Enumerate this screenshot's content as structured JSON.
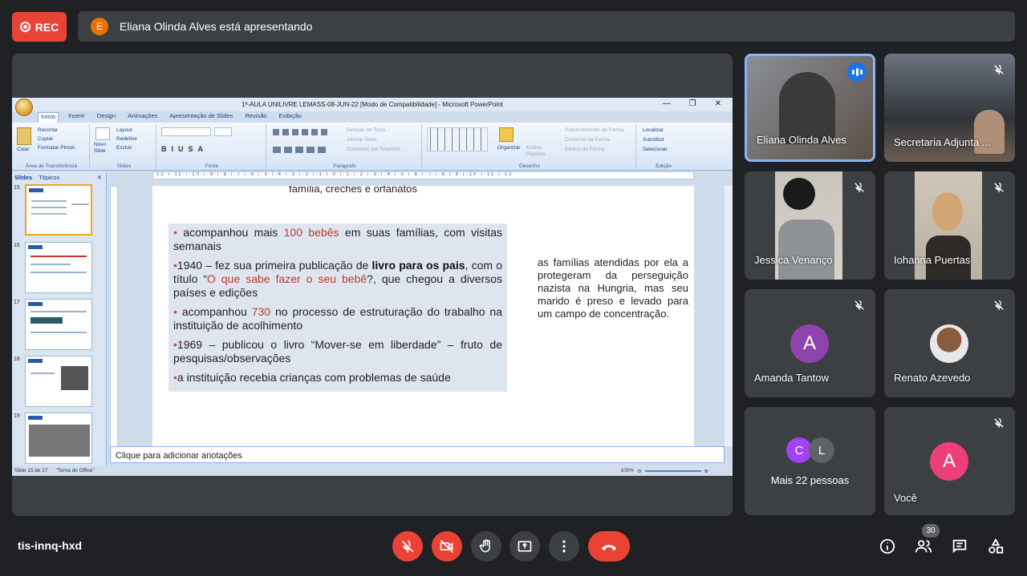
{
  "top_bar": {
    "rec_label": "REC",
    "presenter_initial": "E",
    "presenter_text": "Eliana Olinda Alves está apresentando"
  },
  "ppt": {
    "window_title": "1ª-AULA UNILIVRE LEMASS-08-JUN-22 [Modo de Compatibilidade] - Microsoft PowerPoint",
    "tabs": [
      "Início",
      "Inserir",
      "Design",
      "Animações",
      "Apresentação de Slides",
      "Revisão",
      "Exibição"
    ],
    "ribbon": {
      "clipboard": {
        "paste": "Colar",
        "cut": "Recortar",
        "copy": "Copiar",
        "format_painter": "Formatar Pincel",
        "caption": "Área de Transferência"
      },
      "slides": {
        "new_slide": "Novo Slide",
        "layout": "Layout",
        "reset": "Redefinir",
        "delete": "Excluir",
        "caption": "Slides"
      },
      "font": {
        "caption": "Fonte"
      },
      "paragraph": {
        "text_direction": "Direção do Texto",
        "align_text": "Alinhar Texto",
        "convert_smartart": "Converter em SmartArt",
        "caption": "Parágrafo"
      },
      "drawing": {
        "arrange": "Organizar",
        "quick_styles": "Estilos Rápidos",
        "shape_fill": "Preenchimento da Forma",
        "shape_outline": "Contorno da Forma",
        "shape_effects": "Efeitos de Forma",
        "caption": "Desenho"
      },
      "editing": {
        "find": "Localizar",
        "replace": "Substituir",
        "select": "Selecionar",
        "caption": "Edição"
      }
    },
    "thumb_tabs": [
      "Slides",
      "Tópicos"
    ],
    "thumb_numbers": [
      "15",
      "16",
      "17",
      "18",
      "19"
    ],
    "ruler_text": "·12·ı·11·ı·10·ı·9·ı·8·ı·7·ı·6·ı·5·ı·4·ı·3·ı·2·ı·1·ı·0·ı·1·ı·2·ı·3·ı·4·ı·5·ı·6·ı·7·ı·8·ı·9·ı·10·ı·11·ı·12·",
    "slide": {
      "heading": "família, creches e orfanatos",
      "bullets": [
        {
          "pre": "acompanhou mais ",
          "hl": "100 bebês",
          "post": " em suas famílias, com visitas semanais"
        },
        {
          "year": "1940",
          "pre": " – fez sua primeira publicação de ",
          "bold": "livro para os pais",
          "mid": ", com o título “",
          "hl": "O que sabe fazer o seu bebê",
          "post": "?, que chegou a diversos países e edições"
        },
        {
          "pre": "acompanhou ",
          "hl": "730",
          "post": " no processo de estruturação do trabalho na instituição de acolhimento"
        },
        {
          "year": "1969",
          "pre": " – publicou o livro “Mover-se em liberdade” – fruto de pesquisas/observações"
        },
        {
          "pre": "a instituição recebia crianças com problemas de saúde"
        }
      ],
      "side_text": "as famílias atendidas por ela a protegeram da perseguição nazista na Hungria, mas seu marido é preso e levado para um campo de concentração."
    },
    "notes_placeholder": "Clique para adicionar anotações",
    "status": {
      "slide_info": "Slide 15 de 27",
      "theme": "\"Tema do Office\"",
      "zoom": "100%"
    }
  },
  "participants": [
    {
      "name": "Eliana Olinda Alves",
      "speaking": true
    },
    {
      "name": "Secretaria Adjunta ..."
    },
    {
      "name": "Jessica Venanço"
    },
    {
      "name": "Iohanna Puertas"
    },
    {
      "name": "Amanda Tantow",
      "initial": "A",
      "color": "#8e44ad"
    },
    {
      "name": "Renato Azevedo"
    },
    {
      "more_label": "Mais 22 pessoas",
      "initials": [
        "C",
        "L"
      ],
      "colors": [
        "#a142f4",
        "#5f6368"
      ]
    },
    {
      "name": "Você",
      "initial": "A",
      "color": "#ec407a"
    }
  ],
  "bottom": {
    "meeting_code": "tis-innq-hxd",
    "people_count": "30"
  },
  "colors": {
    "bg": "#202124",
    "tile": "#3c4043",
    "red": "#ea4335",
    "blue": "#1a73e8"
  }
}
